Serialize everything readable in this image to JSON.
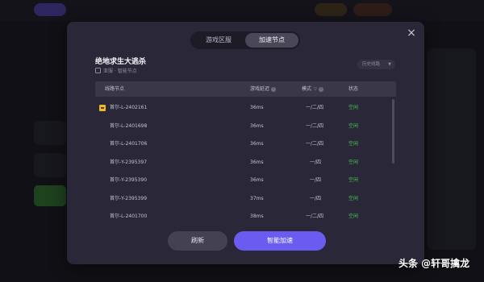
{
  "modal": {
    "close_label": "×",
    "tabs": [
      {
        "label": "游戏区服",
        "active": false
      },
      {
        "label": "加速节点",
        "active": true
      }
    ],
    "game_title": "绝地求生大逃杀",
    "subtitle": "亚服 · 智能节点",
    "history_button": "历史线路",
    "table": {
      "headers": {
        "node": "线路节点",
        "latency": "游戏延迟",
        "mode": "模式",
        "status": "状态"
      },
      "rows": [
        {
          "node": "首尔-L-2402161",
          "latency": "36ms",
          "mode": "一/二/四",
          "status": "空闲"
        },
        {
          "node": "首尔-L-2401698",
          "latency": "36ms",
          "mode": "一/二/四",
          "status": "空闲"
        },
        {
          "node": "首尔-L-2401706",
          "latency": "36ms",
          "mode": "一/二/四",
          "status": "空闲"
        },
        {
          "node": "首尔-Y-2395397",
          "latency": "36ms",
          "mode": "一/四",
          "status": "空闲"
        },
        {
          "node": "首尔-Y-2395390",
          "latency": "36ms",
          "mode": "一/四",
          "status": "空闲"
        },
        {
          "node": "首尔-Y-2395399",
          "latency": "37ms",
          "mode": "一/四",
          "status": "空闲"
        },
        {
          "node": "首尔-L-2401700",
          "latency": "38ms",
          "mode": "一/二/四",
          "status": "空闲"
        }
      ]
    },
    "refresh_button": "刷新",
    "accelerate_button": "智能加速"
  },
  "watermark": "头条 @轩哥擒龙",
  "colors": {
    "accent": "#6a5cf0",
    "status_idle": "#47c553",
    "modal_bg": "#2a2838"
  }
}
